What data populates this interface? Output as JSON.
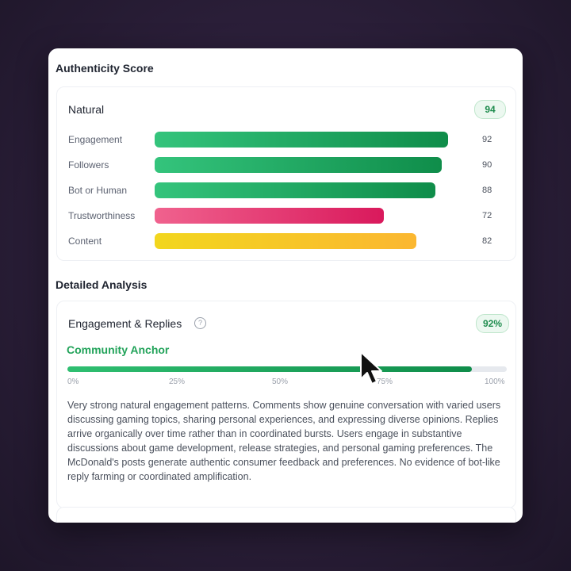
{
  "authenticity": {
    "title": "Authenticity Score",
    "label": "Natural",
    "score": "94",
    "metrics": [
      {
        "label": "Engagement",
        "value": "92",
        "fraction": 0.92,
        "color_start": "#34c47c",
        "color_end": "#0f8d4a"
      },
      {
        "label": "Followers",
        "value": "90",
        "fraction": 0.9,
        "color_start": "#34c47c",
        "color_end": "#0f8d4a"
      },
      {
        "label": "Bot or Human",
        "value": "88",
        "fraction": 0.88,
        "color_start": "#34c47c",
        "color_end": "#0f8d4a"
      },
      {
        "label": "Trustworthiness",
        "value": "72",
        "fraction": 0.72,
        "color_start": "#f0628e",
        "color_end": "#d9195c"
      },
      {
        "label": "Content",
        "value": "82",
        "fraction": 0.82,
        "color_start": "#f2d61e",
        "color_end": "#fbb731"
      }
    ]
  },
  "analysis": {
    "title": "Detailed Analysis",
    "item": {
      "name": "Engagement & Replies",
      "help_icon": "?",
      "score": "92%",
      "category": "Community Anchor",
      "progress": 0.92,
      "ticks": [
        "0%",
        "25%",
        "50%",
        "75%",
        "100%"
      ],
      "description": "Very strong natural engagement patterns. Comments show genuine conversation with varied users discussing gaming topics, sharing personal experiences, and expressing diverse opinions. Replies arrive organically over time rather than in coordinated bursts. Users engage in substantive discussions about game development, release strategies, and personal gaming preferences. The McDonald's posts generate authentic consumer feedback and preferences. No evidence of bot-like reply farming or coordinated amplification."
    }
  },
  "colors": {
    "accent_green": "#22a35a",
    "track": "#e6e9ee"
  },
  "icons": {
    "help": "help-circle-icon",
    "cursor": "mouse-pointer-icon"
  }
}
